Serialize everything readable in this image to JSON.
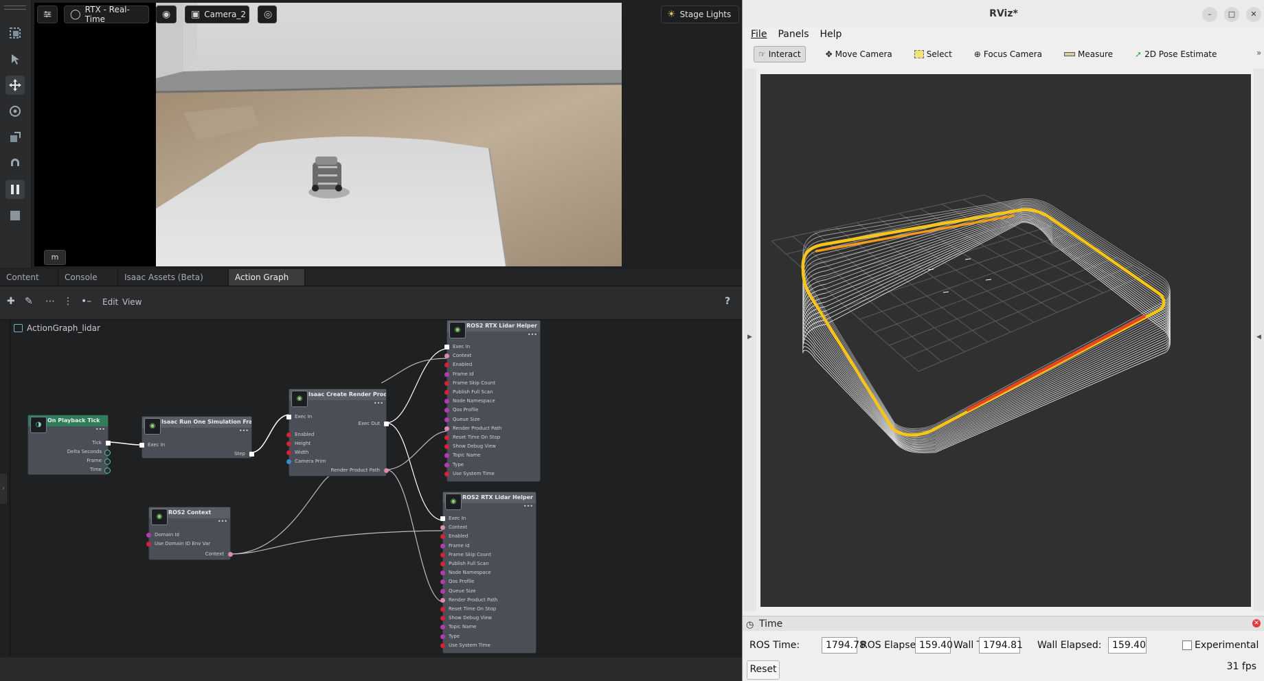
{
  "isaac": {
    "viewport": {
      "renderer": "RTX - Real-Time",
      "camera": "Camera_2",
      "lights": "Stage Lights",
      "badge": "m"
    },
    "tabs": [
      {
        "label": "Content"
      },
      {
        "label": "Console"
      },
      {
        "label": "Isaac Assets (Beta)"
      },
      {
        "label": "Action Graph"
      }
    ],
    "graph_menu": {
      "edit": "Edit",
      "view": "View",
      "help": "?"
    },
    "graph_name": "ActionGraph_lidar",
    "nodes": {
      "tick": {
        "title": "On Playback Tick",
        "outputs": [
          "Tick",
          "Delta Seconds",
          "Frame",
          "Time"
        ]
      },
      "sim": {
        "title": "Isaac Run One Simulation Frame",
        "inputs": [
          "Exec In"
        ],
        "outputs": [
          "Step"
        ]
      },
      "render": {
        "title": "Isaac Create Render Product",
        "inputs": [
          "Exec In",
          "Enabled",
          "Height",
          "Width",
          "Camera Prim"
        ],
        "outputs": [
          "Exec Out",
          "Render Product Path"
        ]
      },
      "ctx": {
        "title": "ROS2 Context",
        "inputs": [
          "Domain Id",
          "Use Domain ID Env Var"
        ],
        "outputs": [
          "Context"
        ]
      },
      "lidar1": {
        "title": "ROS2 RTX Lidar Helper",
        "inputs": [
          "Exec In",
          "Context",
          "Enabled",
          "Frame Id",
          "Frame Skip Count",
          "Publish Full Scan",
          "Node Namespace",
          "Qos Profile",
          "Queue Size",
          "Render Product Path",
          "Reset Time On Stop",
          "Show Debug View",
          "Topic Name",
          "Type",
          "Use System Time"
        ]
      },
      "lidar2": {
        "title": "ROS2 RTX Lidar Helper",
        "inputs": [
          "Exec In",
          "Context",
          "Enabled",
          "Frame Id",
          "Frame Skip Count",
          "Publish Full Scan",
          "Node Namespace",
          "Qos Profile",
          "Queue Size",
          "Render Product Path",
          "Reset Time On Stop",
          "Show Debug View",
          "Topic Name",
          "Type",
          "Use System Time"
        ]
      }
    }
  },
  "rviz": {
    "title": "RViz*",
    "menu": [
      "File",
      "Panels",
      "Help"
    ],
    "tools": [
      {
        "label": "Interact",
        "icon": "cursor-icon"
      },
      {
        "label": "Move Camera",
        "icon": "move-icon"
      },
      {
        "label": "Select",
        "icon": "select-icon"
      },
      {
        "label": "Focus Camera",
        "icon": "focus-icon"
      },
      {
        "label": "Measure",
        "icon": "ruler-icon"
      },
      {
        "label": "2D Pose Estimate",
        "icon": "arrow-icon"
      }
    ],
    "time_panel": {
      "title": "Time",
      "ros_time_label": "ROS Time:",
      "ros_time": "1794.78",
      "ros_elapsed_label": "ROS Elapsed:",
      "ros_elapsed": "159.40",
      "wall_time_label": "Wall Time:",
      "wall_time": "1794.81",
      "wall_elapsed_label": "Wall Elapsed:",
      "wall_elapsed": "159.40",
      "experimental_label": "Experimental",
      "reset_label": "Reset",
      "fps": "31 fps"
    }
  }
}
